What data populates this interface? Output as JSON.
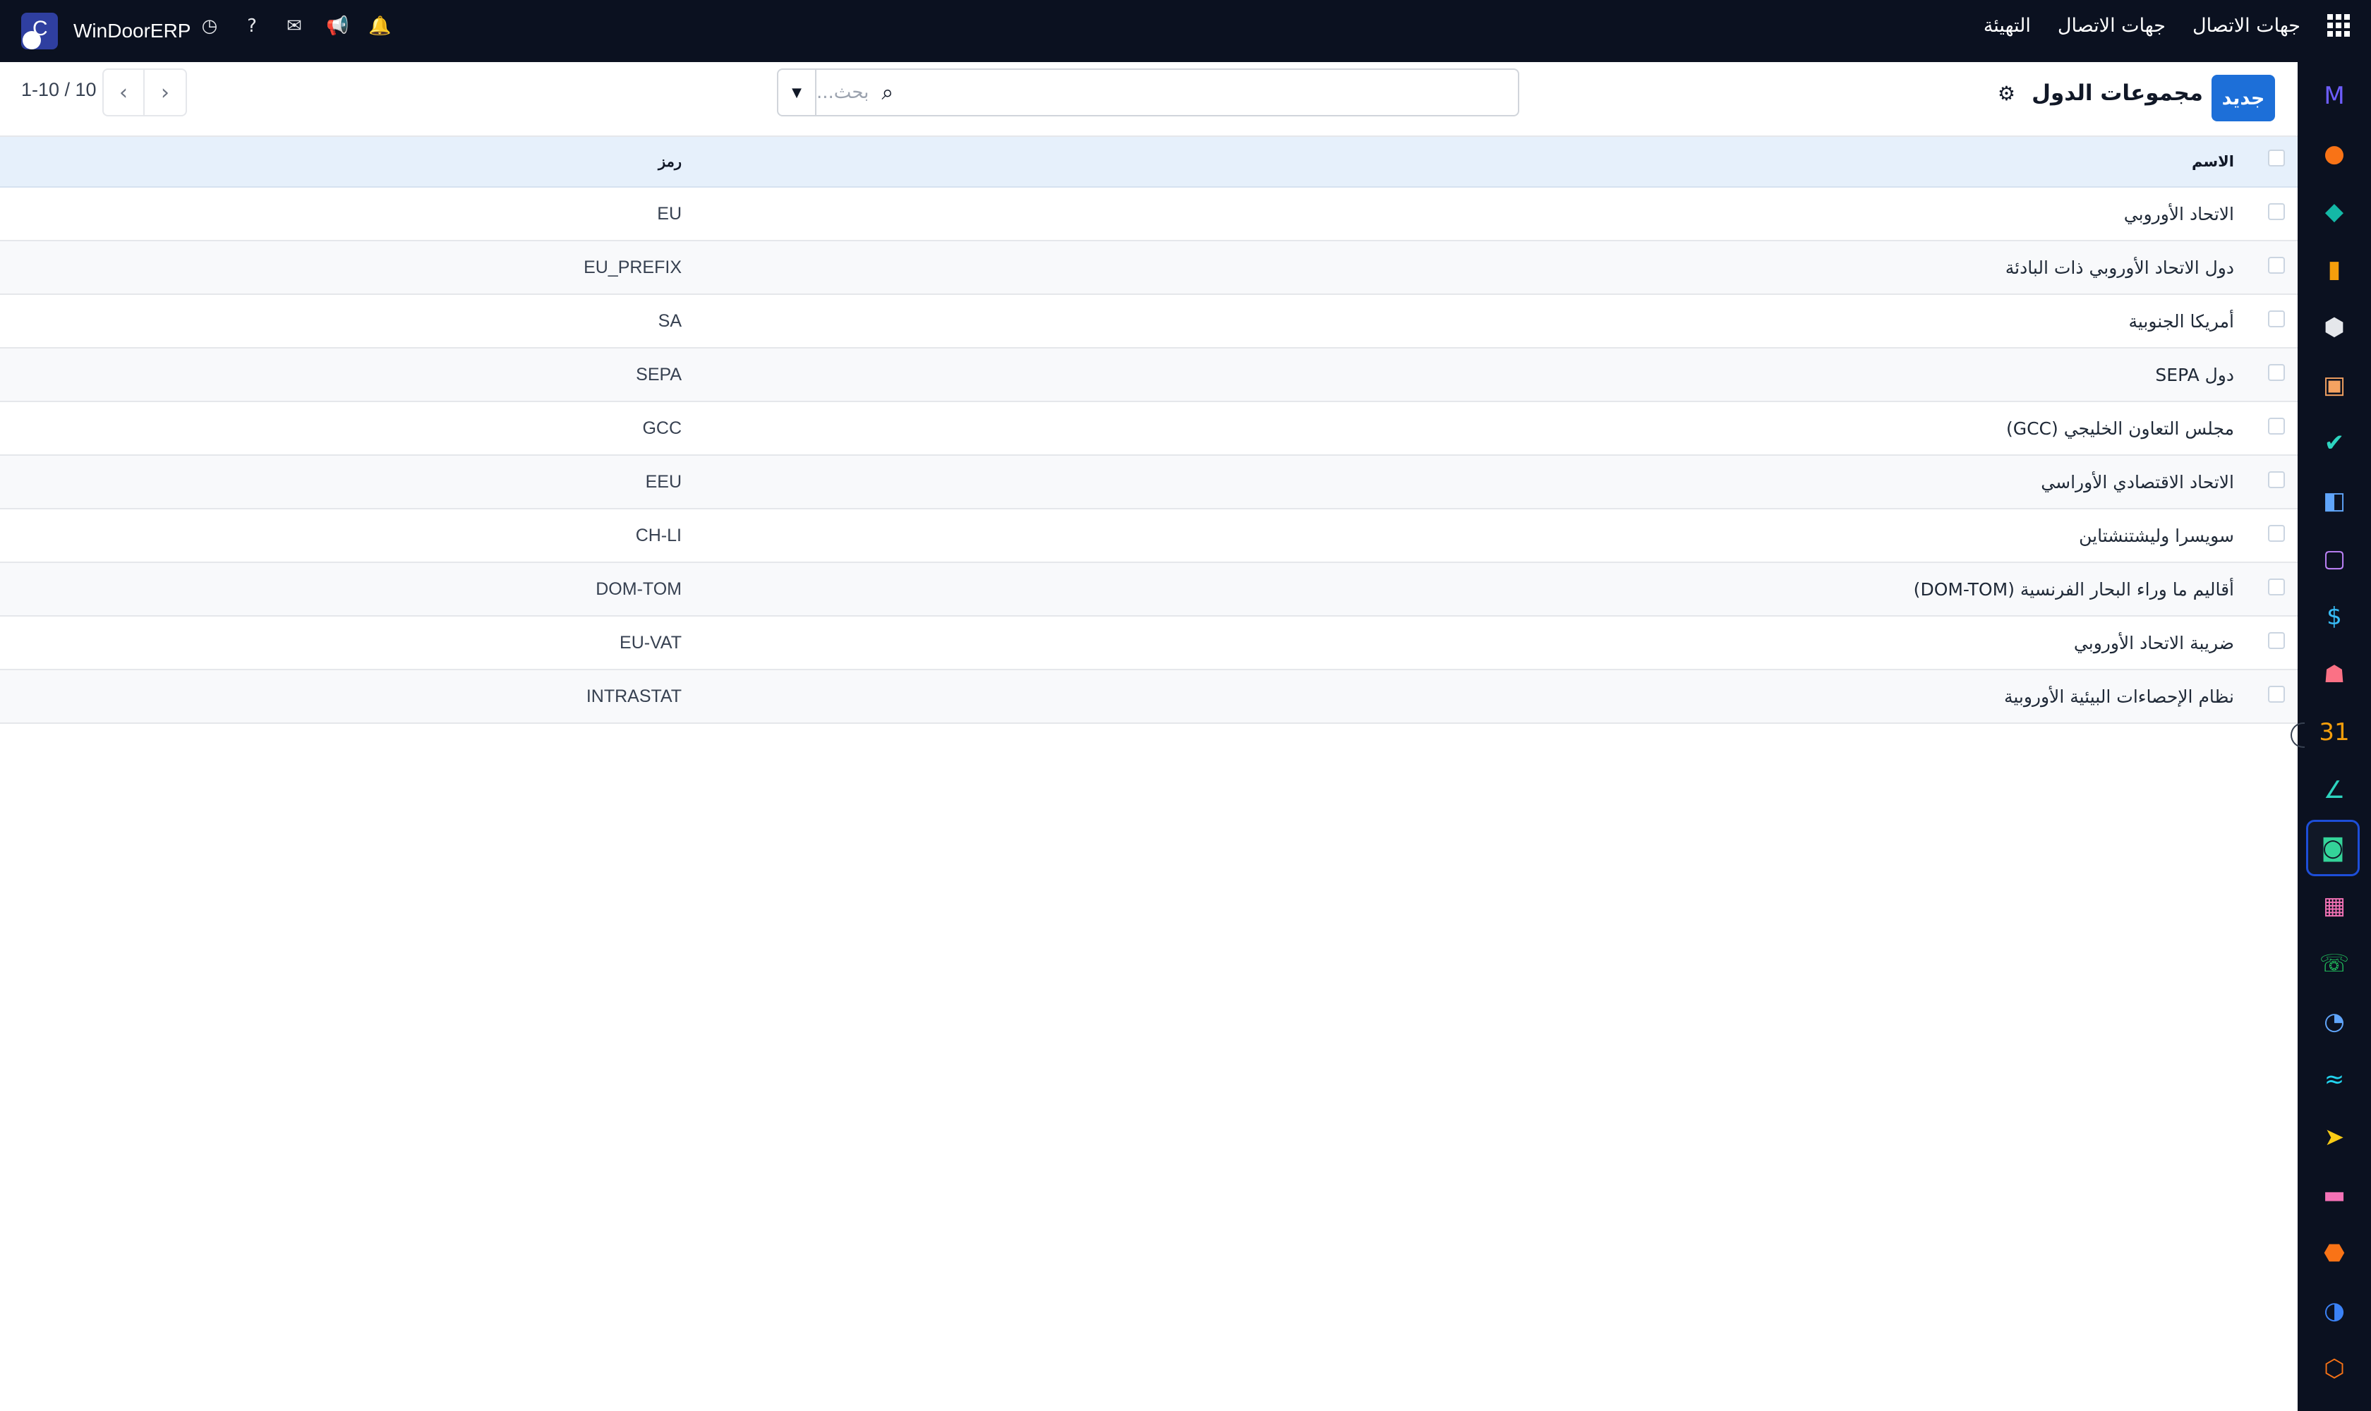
{
  "app": {
    "brand": "WinDoorERP"
  },
  "topbar": {
    "menu": [
      "جهات الاتصال",
      "جهات الاتصال",
      "التهيئة"
    ],
    "icons": [
      "bell-icon",
      "megaphone-icon",
      "chat-icon",
      "help-icon",
      "clock-icon"
    ]
  },
  "control": {
    "new_label": "جديد",
    "title": "مجموعات الدول",
    "search_placeholder": "بحث...",
    "pager_text": "1-10 / 10"
  },
  "table": {
    "headers": {
      "name": "الاسم",
      "code": "رمز"
    },
    "rows": [
      {
        "name": "الاتحاد الأوروبي",
        "code": "EU"
      },
      {
        "name": "دول الاتحاد الأوروبي ذات البادئة",
        "code": "EU_PREFIX"
      },
      {
        "name": "أمريكا الجنوبية",
        "code": "SA"
      },
      {
        "name": "دول SEPA",
        "code": "SEPA"
      },
      {
        "name": "مجلس التعاون الخليجي (GCC)",
        "code": "GCC"
      },
      {
        "name": "الاتحاد الاقتصادي الأوراسي",
        "code": "EEU"
      },
      {
        "name": "سويسرا وليشتنشتاين",
        "code": "CH-LI"
      },
      {
        "name": "أقاليم ما وراء البحار الفرنسية (DOM-TOM)",
        "code": "DOM-TOM"
      },
      {
        "name": "ضريبة الاتحاد الأوروبي",
        "code": "EU-VAT"
      },
      {
        "name": "نظام الإحصاءات البيئية الأوروبية",
        "code": "INTRASTAT"
      }
    ]
  },
  "sidebar_apps": [
    {
      "icon": "M",
      "color": "#6d5dfc"
    },
    {
      "icon": "●",
      "color": "#f97316"
    },
    {
      "icon": "◆",
      "color": "#14b8a6"
    },
    {
      "icon": "▮",
      "color": "#f59e0b"
    },
    {
      "icon": "⬢",
      "color": "#e5e7eb"
    },
    {
      "icon": "▣",
      "color": "#f4a261"
    },
    {
      "icon": "✔",
      "color": "#2dd4bf"
    },
    {
      "icon": "◧",
      "color": "#60a5fa"
    },
    {
      "icon": "▢",
      "color": "#c084fc"
    },
    {
      "icon": "$",
      "color": "#38bdf8"
    },
    {
      "icon": "☗",
      "color": "#fb7185"
    },
    {
      "icon": "31",
      "color": "#f59e0b"
    },
    {
      "icon": "∠",
      "color": "#2dd4bf"
    },
    {
      "icon": "◙",
      "color": "#34d399"
    },
    {
      "icon": "▦",
      "color": "#f472b6"
    },
    {
      "icon": "☏",
      "color": "#22c55e"
    },
    {
      "icon": "◔",
      "color": "#60a5fa"
    },
    {
      "icon": "≈",
      "color": "#22d3ee"
    },
    {
      "icon": "➤",
      "color": "#facc15"
    },
    {
      "icon": "▬",
      "color": "#f472b6"
    },
    {
      "icon": "⬣",
      "color": "#f97316"
    },
    {
      "icon": "◑",
      "color": "#3b82f6"
    },
    {
      "icon": "⬡",
      "color": "#f97316"
    }
  ]
}
